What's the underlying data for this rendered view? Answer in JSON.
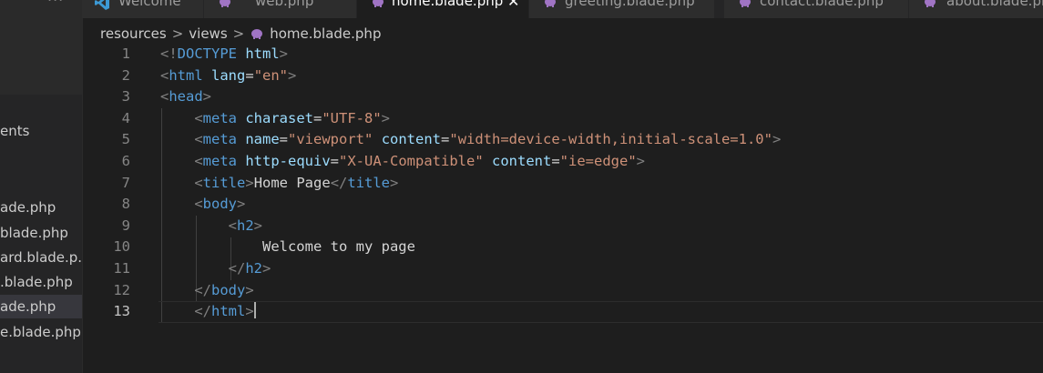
{
  "sidebar": {
    "section_label": "ents",
    "files": [
      {
        "label": "ade.php",
        "active": false
      },
      {
        "label": "blade.php",
        "active": false
      },
      {
        "label": "ard.blade.p...",
        "active": false
      },
      {
        "label": ".blade.php",
        "active": false
      },
      {
        "label": "ade.php",
        "active": true
      },
      {
        "label": "e.blade.php",
        "active": false
      }
    ]
  },
  "tabs": [
    {
      "label": "Welcome",
      "icon": "vscode-icon",
      "active": false
    },
    {
      "label": "web.php",
      "icon": "php-elephant-icon",
      "active": false
    },
    {
      "label": "home.blade.php",
      "icon": "php-elephant-icon",
      "active": true
    },
    {
      "label": "greeting.blade.php",
      "icon": "php-elephant-icon",
      "active": false
    },
    {
      "label": "contact.blade.php",
      "icon": "php-elephant-icon",
      "active": false
    },
    {
      "label": "about.blade.ph",
      "icon": "php-elephant-icon",
      "active": false
    }
  ],
  "breadcrumb": {
    "parts": [
      "resources",
      "views",
      "home.blade.php"
    ]
  },
  "editor": {
    "current_line": 13,
    "lines": [
      {
        "n": "1",
        "tokens": [
          [
            "p",
            "<!"
          ],
          [
            "t",
            "DOCTYPE"
          ],
          [
            "x",
            " "
          ],
          [
            "a",
            "html"
          ],
          [
            "p",
            ">"
          ]
        ]
      },
      {
        "n": "2",
        "tokens": [
          [
            "p",
            "<"
          ],
          [
            "t",
            "html"
          ],
          [
            "x",
            " "
          ],
          [
            "a",
            "lang"
          ],
          [
            "x",
            "="
          ],
          [
            "s",
            "\"en\""
          ],
          [
            "p",
            ">"
          ]
        ]
      },
      {
        "n": "3",
        "tokens": [
          [
            "p",
            "<"
          ],
          [
            "t",
            "head"
          ],
          [
            "p",
            ">"
          ]
        ]
      },
      {
        "n": "4",
        "tokens": [
          [
            "x",
            "    "
          ],
          [
            "p",
            "<"
          ],
          [
            "t",
            "meta"
          ],
          [
            "x",
            " "
          ],
          [
            "a",
            "charaset"
          ],
          [
            "x",
            "="
          ],
          [
            "s",
            "\"UTF-8\""
          ],
          [
            "p",
            ">"
          ]
        ]
      },
      {
        "n": "5",
        "tokens": [
          [
            "x",
            "    "
          ],
          [
            "p",
            "<"
          ],
          [
            "t",
            "meta"
          ],
          [
            "x",
            " "
          ],
          [
            "a",
            "name"
          ],
          [
            "x",
            "="
          ],
          [
            "s",
            "\"viewport\""
          ],
          [
            "x",
            " "
          ],
          [
            "a",
            "content"
          ],
          [
            "x",
            "="
          ],
          [
            "s",
            "\"width=device-width,initial-scale=1.0\""
          ],
          [
            "p",
            ">"
          ]
        ]
      },
      {
        "n": "6",
        "tokens": [
          [
            "x",
            "    "
          ],
          [
            "p",
            "<"
          ],
          [
            "t",
            "meta"
          ],
          [
            "x",
            " "
          ],
          [
            "a",
            "http-equiv"
          ],
          [
            "x",
            "="
          ],
          [
            "s",
            "\"X-UA-Compatible\""
          ],
          [
            "x",
            " "
          ],
          [
            "a",
            "content"
          ],
          [
            "x",
            "="
          ],
          [
            "s",
            "\"ie=edge\""
          ],
          [
            "p",
            ">"
          ]
        ]
      },
      {
        "n": "7",
        "tokens": [
          [
            "x",
            "    "
          ],
          [
            "p",
            "<"
          ],
          [
            "t",
            "title"
          ],
          [
            "p",
            ">"
          ],
          [
            "x",
            "Home Page"
          ],
          [
            "p",
            "</"
          ],
          [
            "t",
            "title"
          ],
          [
            "p",
            ">"
          ]
        ]
      },
      {
        "n": "8",
        "tokens": [
          [
            "x",
            "    "
          ],
          [
            "p",
            "<"
          ],
          [
            "t",
            "body"
          ],
          [
            "p",
            ">"
          ]
        ]
      },
      {
        "n": "9",
        "tokens": [
          [
            "x",
            "        "
          ],
          [
            "p",
            "<"
          ],
          [
            "t",
            "h2"
          ],
          [
            "p",
            ">"
          ]
        ]
      },
      {
        "n": "10",
        "tokens": [
          [
            "x",
            "            Welcome to my page"
          ]
        ]
      },
      {
        "n": "11",
        "tokens": [
          [
            "x",
            "        "
          ],
          [
            "p",
            "</"
          ],
          [
            "t",
            "h2"
          ],
          [
            "p",
            ">"
          ]
        ]
      },
      {
        "n": "12",
        "tokens": [
          [
            "x",
            "    "
          ],
          [
            "p",
            "</"
          ],
          [
            "t",
            "body"
          ],
          [
            "p",
            ">"
          ]
        ]
      },
      {
        "n": "13",
        "tokens": [
          [
            "x",
            "    "
          ],
          [
            "p",
            "</"
          ],
          [
            "t",
            "html"
          ],
          [
            "p",
            ">"
          ]
        ]
      }
    ]
  },
  "colors": {
    "editor_bg": "#1e1e1e",
    "tag": "#569cd6",
    "attribute": "#9cdcfe",
    "string": "#ce9178",
    "punctuation": "#808080"
  }
}
